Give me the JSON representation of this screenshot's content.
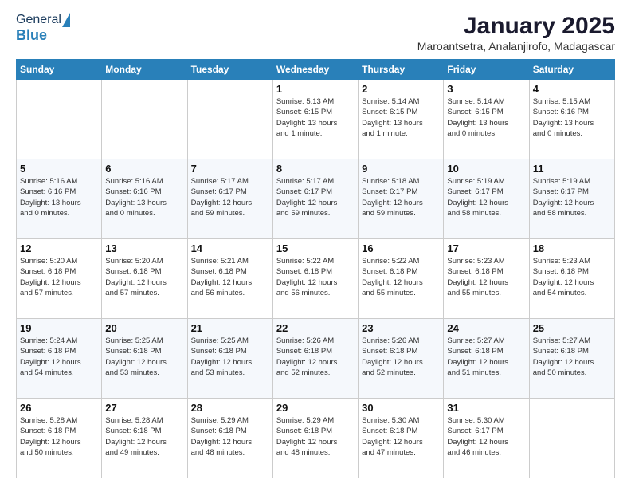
{
  "header": {
    "logo_general": "General",
    "logo_blue": "Blue",
    "title": "January 2025",
    "subtitle": "Maroantsetra, Analanjirofo, Madagascar"
  },
  "weekdays": [
    "Sunday",
    "Monday",
    "Tuesday",
    "Wednesday",
    "Thursday",
    "Friday",
    "Saturday"
  ],
  "weeks": [
    [
      {
        "day": "",
        "info": ""
      },
      {
        "day": "",
        "info": ""
      },
      {
        "day": "",
        "info": ""
      },
      {
        "day": "1",
        "info": "Sunrise: 5:13 AM\nSunset: 6:15 PM\nDaylight: 13 hours\nand 1 minute."
      },
      {
        "day": "2",
        "info": "Sunrise: 5:14 AM\nSunset: 6:15 PM\nDaylight: 13 hours\nand 1 minute."
      },
      {
        "day": "3",
        "info": "Sunrise: 5:14 AM\nSunset: 6:15 PM\nDaylight: 13 hours\nand 0 minutes."
      },
      {
        "day": "4",
        "info": "Sunrise: 5:15 AM\nSunset: 6:16 PM\nDaylight: 13 hours\nand 0 minutes."
      }
    ],
    [
      {
        "day": "5",
        "info": "Sunrise: 5:16 AM\nSunset: 6:16 PM\nDaylight: 13 hours\nand 0 minutes."
      },
      {
        "day": "6",
        "info": "Sunrise: 5:16 AM\nSunset: 6:16 PM\nDaylight: 13 hours\nand 0 minutes."
      },
      {
        "day": "7",
        "info": "Sunrise: 5:17 AM\nSunset: 6:17 PM\nDaylight: 12 hours\nand 59 minutes."
      },
      {
        "day": "8",
        "info": "Sunrise: 5:17 AM\nSunset: 6:17 PM\nDaylight: 12 hours\nand 59 minutes."
      },
      {
        "day": "9",
        "info": "Sunrise: 5:18 AM\nSunset: 6:17 PM\nDaylight: 12 hours\nand 59 minutes."
      },
      {
        "day": "10",
        "info": "Sunrise: 5:19 AM\nSunset: 6:17 PM\nDaylight: 12 hours\nand 58 minutes."
      },
      {
        "day": "11",
        "info": "Sunrise: 5:19 AM\nSunset: 6:17 PM\nDaylight: 12 hours\nand 58 minutes."
      }
    ],
    [
      {
        "day": "12",
        "info": "Sunrise: 5:20 AM\nSunset: 6:18 PM\nDaylight: 12 hours\nand 57 minutes."
      },
      {
        "day": "13",
        "info": "Sunrise: 5:20 AM\nSunset: 6:18 PM\nDaylight: 12 hours\nand 57 minutes."
      },
      {
        "day": "14",
        "info": "Sunrise: 5:21 AM\nSunset: 6:18 PM\nDaylight: 12 hours\nand 56 minutes."
      },
      {
        "day": "15",
        "info": "Sunrise: 5:22 AM\nSunset: 6:18 PM\nDaylight: 12 hours\nand 56 minutes."
      },
      {
        "day": "16",
        "info": "Sunrise: 5:22 AM\nSunset: 6:18 PM\nDaylight: 12 hours\nand 55 minutes."
      },
      {
        "day": "17",
        "info": "Sunrise: 5:23 AM\nSunset: 6:18 PM\nDaylight: 12 hours\nand 55 minutes."
      },
      {
        "day": "18",
        "info": "Sunrise: 5:23 AM\nSunset: 6:18 PM\nDaylight: 12 hours\nand 54 minutes."
      }
    ],
    [
      {
        "day": "19",
        "info": "Sunrise: 5:24 AM\nSunset: 6:18 PM\nDaylight: 12 hours\nand 54 minutes."
      },
      {
        "day": "20",
        "info": "Sunrise: 5:25 AM\nSunset: 6:18 PM\nDaylight: 12 hours\nand 53 minutes."
      },
      {
        "day": "21",
        "info": "Sunrise: 5:25 AM\nSunset: 6:18 PM\nDaylight: 12 hours\nand 53 minutes."
      },
      {
        "day": "22",
        "info": "Sunrise: 5:26 AM\nSunset: 6:18 PM\nDaylight: 12 hours\nand 52 minutes."
      },
      {
        "day": "23",
        "info": "Sunrise: 5:26 AM\nSunset: 6:18 PM\nDaylight: 12 hours\nand 52 minutes."
      },
      {
        "day": "24",
        "info": "Sunrise: 5:27 AM\nSunset: 6:18 PM\nDaylight: 12 hours\nand 51 minutes."
      },
      {
        "day": "25",
        "info": "Sunrise: 5:27 AM\nSunset: 6:18 PM\nDaylight: 12 hours\nand 50 minutes."
      }
    ],
    [
      {
        "day": "26",
        "info": "Sunrise: 5:28 AM\nSunset: 6:18 PM\nDaylight: 12 hours\nand 50 minutes."
      },
      {
        "day": "27",
        "info": "Sunrise: 5:28 AM\nSunset: 6:18 PM\nDaylight: 12 hours\nand 49 minutes."
      },
      {
        "day": "28",
        "info": "Sunrise: 5:29 AM\nSunset: 6:18 PM\nDaylight: 12 hours\nand 48 minutes."
      },
      {
        "day": "29",
        "info": "Sunrise: 5:29 AM\nSunset: 6:18 PM\nDaylight: 12 hours\nand 48 minutes."
      },
      {
        "day": "30",
        "info": "Sunrise: 5:30 AM\nSunset: 6:18 PM\nDaylight: 12 hours\nand 47 minutes."
      },
      {
        "day": "31",
        "info": "Sunrise: 5:30 AM\nSunset: 6:17 PM\nDaylight: 12 hours\nand 46 minutes."
      },
      {
        "day": "",
        "info": ""
      }
    ]
  ]
}
